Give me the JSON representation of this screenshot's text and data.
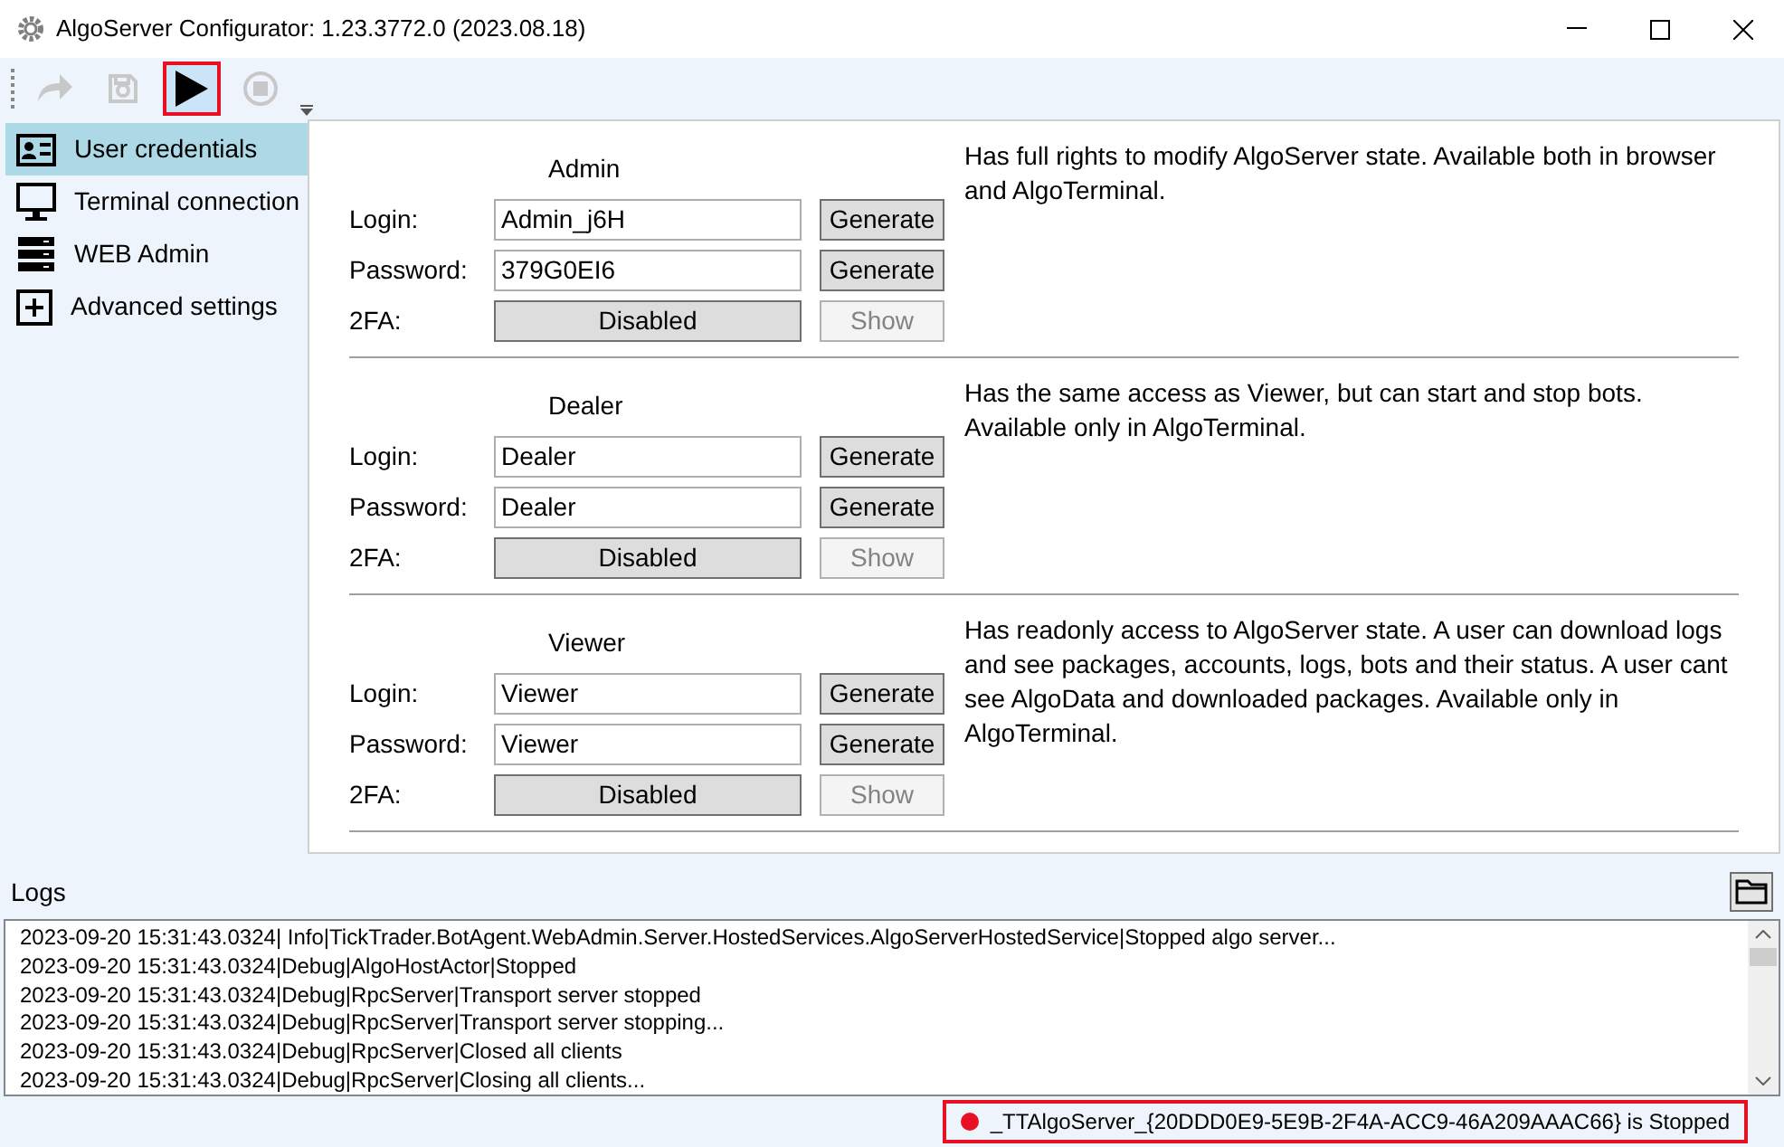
{
  "window": {
    "title": "AlgoServer Configurator: 1.23.3772.0 (2023.08.18)"
  },
  "toolbar": [
    {
      "kind": "redo",
      "disabled": true,
      "highlighted": false
    },
    {
      "kind": "save",
      "disabled": true,
      "highlighted": false
    },
    {
      "kind": "play",
      "disabled": false,
      "highlighted": true
    },
    {
      "kind": "stop",
      "disabled": true,
      "highlighted": false
    }
  ],
  "sidebar": {
    "items": [
      {
        "kind": "card",
        "label": "User credentials",
        "selected": true
      },
      {
        "kind": "monitor",
        "label": "Terminal connection",
        "selected": false
      },
      {
        "kind": "server",
        "label": "WEB Admin",
        "selected": false
      },
      {
        "kind": "plus",
        "label": "Advanced settings",
        "selected": false
      }
    ]
  },
  "users": [
    {
      "title": "Admin",
      "login_label": "Login:",
      "login": "Admin_j6H",
      "password_label": "Password:",
      "password": "379G0EI6",
      "twofa_label": "2FA:",
      "twofa": "Disabled",
      "login_generate": "Generate",
      "password_generate": "Generate",
      "show": "Show",
      "show_disabled": true,
      "description": "Has full rights to modify AlgoServer state. Available both in browser and AlgoTerminal."
    },
    {
      "title": "Dealer",
      "login_label": "Login:",
      "login": "Dealer",
      "password_label": "Password:",
      "password": "Dealer",
      "twofa_label": "2FA:",
      "twofa": "Disabled",
      "login_generate": "Generate",
      "password_generate": "Generate",
      "show": "Show",
      "show_disabled": true,
      "description": "Has the same access as Viewer, but can start and stop bots. Available only in AlgoTerminal."
    },
    {
      "title": "Viewer",
      "login_label": "Login:",
      "login": "Viewer",
      "password_label": "Password:",
      "password": "Viewer",
      "twofa_label": "2FA:",
      "twofa": "Disabled",
      "login_generate": "Generate",
      "password_generate": "Generate",
      "show": "Show",
      "show_disabled": true,
      "description": "Has readonly access to AlgoServer state. A user can download logs and see packages, accounts, logs, bots and their status. A user cant see AlgoData and downloaded packages. Available only in AlgoTerminal."
    }
  ],
  "logs": {
    "title": "Logs",
    "lines": [
      "2023-09-20 15:31:43.0324| Info|TickTrader.BotAgent.WebAdmin.Server.HostedServices.AlgoServerHostedService|Stopped algo server...",
      "2023-09-20 15:31:43.0324|Debug|AlgoHostActor|Stopped",
      "2023-09-20 15:31:43.0324|Debug|RpcServer|Transport server stopped",
      "2023-09-20 15:31:43.0324|Debug|RpcServer|Transport server stopping...",
      "2023-09-20 15:31:43.0324|Debug|RpcServer|Closed all clients",
      "2023-09-20 15:31:43.0324|Debug|RpcServer|Closing all clients..."
    ]
  },
  "status_bar": {
    "text": "_TTAlgoServer_{20DDD0E9-5E9B-2F4A-ACC9-46A209AAAC66} is Stopped",
    "color": "#e81123"
  }
}
